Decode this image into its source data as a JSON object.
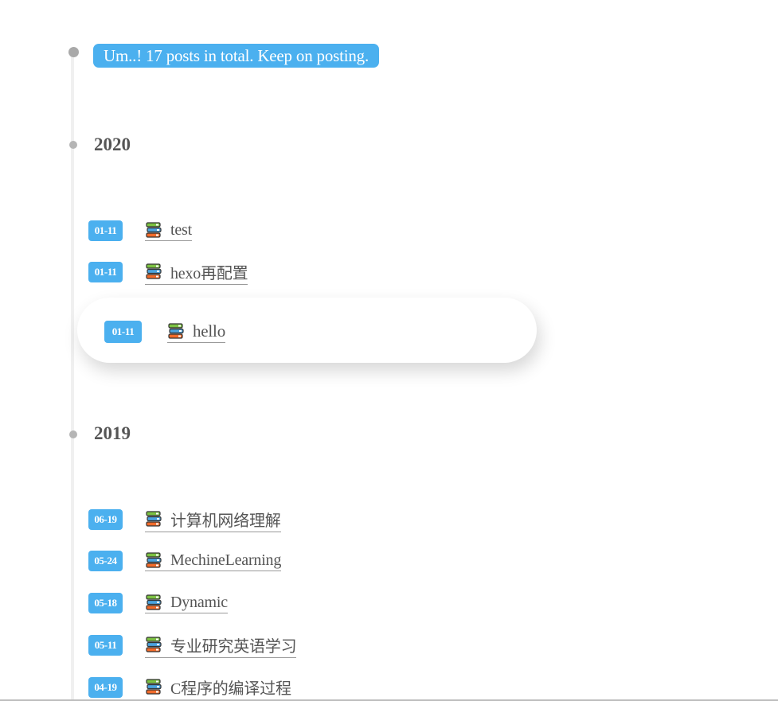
{
  "summary": "Um..! 17 posts in total. Keep on posting.",
  "accent_color": "#4bb0ef",
  "icon": "books-icon",
  "years": [
    {
      "year": "2020",
      "posts": [
        {
          "date": "01-11",
          "title": "test"
        },
        {
          "date": "01-11",
          "title": "hexo再配置"
        },
        {
          "date": "01-11",
          "title": "hello"
        }
      ]
    },
    {
      "year": "2019",
      "posts": [
        {
          "date": "06-19",
          "title": "计算机网络理解"
        },
        {
          "date": "05-24",
          "title": "MechineLearning"
        },
        {
          "date": "05-18",
          "title": "Dynamic"
        },
        {
          "date": "05-11",
          "title": "专业研究英语学习"
        },
        {
          "date": "04-19",
          "title": "C程序的编译过程"
        }
      ]
    }
  ]
}
